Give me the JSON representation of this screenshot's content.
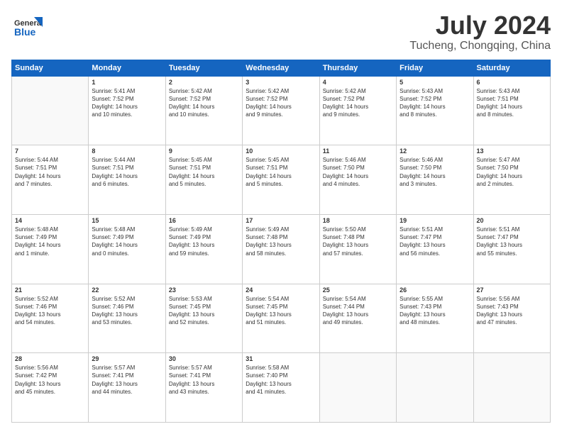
{
  "header": {
    "logo_line1": "General",
    "logo_line2": "Blue",
    "month": "July 2024",
    "location": "Tucheng, Chongqing, China"
  },
  "weekdays": [
    "Sunday",
    "Monday",
    "Tuesday",
    "Wednesday",
    "Thursday",
    "Friday",
    "Saturday"
  ],
  "weeks": [
    [
      {
        "day": "",
        "info": ""
      },
      {
        "day": "1",
        "info": "Sunrise: 5:41 AM\nSunset: 7:52 PM\nDaylight: 14 hours\nand 10 minutes."
      },
      {
        "day": "2",
        "info": "Sunrise: 5:42 AM\nSunset: 7:52 PM\nDaylight: 14 hours\nand 10 minutes."
      },
      {
        "day": "3",
        "info": "Sunrise: 5:42 AM\nSunset: 7:52 PM\nDaylight: 14 hours\nand 9 minutes."
      },
      {
        "day": "4",
        "info": "Sunrise: 5:42 AM\nSunset: 7:52 PM\nDaylight: 14 hours\nand 9 minutes."
      },
      {
        "day": "5",
        "info": "Sunrise: 5:43 AM\nSunset: 7:52 PM\nDaylight: 14 hours\nand 8 minutes."
      },
      {
        "day": "6",
        "info": "Sunrise: 5:43 AM\nSunset: 7:51 PM\nDaylight: 14 hours\nand 8 minutes."
      }
    ],
    [
      {
        "day": "7",
        "info": "Sunrise: 5:44 AM\nSunset: 7:51 PM\nDaylight: 14 hours\nand 7 minutes."
      },
      {
        "day": "8",
        "info": "Sunrise: 5:44 AM\nSunset: 7:51 PM\nDaylight: 14 hours\nand 6 minutes."
      },
      {
        "day": "9",
        "info": "Sunrise: 5:45 AM\nSunset: 7:51 PM\nDaylight: 14 hours\nand 5 minutes."
      },
      {
        "day": "10",
        "info": "Sunrise: 5:45 AM\nSunset: 7:51 PM\nDaylight: 14 hours\nand 5 minutes."
      },
      {
        "day": "11",
        "info": "Sunrise: 5:46 AM\nSunset: 7:50 PM\nDaylight: 14 hours\nand 4 minutes."
      },
      {
        "day": "12",
        "info": "Sunrise: 5:46 AM\nSunset: 7:50 PM\nDaylight: 14 hours\nand 3 minutes."
      },
      {
        "day": "13",
        "info": "Sunrise: 5:47 AM\nSunset: 7:50 PM\nDaylight: 14 hours\nand 2 minutes."
      }
    ],
    [
      {
        "day": "14",
        "info": "Sunrise: 5:48 AM\nSunset: 7:49 PM\nDaylight: 14 hours\nand 1 minute."
      },
      {
        "day": "15",
        "info": "Sunrise: 5:48 AM\nSunset: 7:49 PM\nDaylight: 14 hours\nand 0 minutes."
      },
      {
        "day": "16",
        "info": "Sunrise: 5:49 AM\nSunset: 7:49 PM\nDaylight: 13 hours\nand 59 minutes."
      },
      {
        "day": "17",
        "info": "Sunrise: 5:49 AM\nSunset: 7:48 PM\nDaylight: 13 hours\nand 58 minutes."
      },
      {
        "day": "18",
        "info": "Sunrise: 5:50 AM\nSunset: 7:48 PM\nDaylight: 13 hours\nand 57 minutes."
      },
      {
        "day": "19",
        "info": "Sunrise: 5:51 AM\nSunset: 7:47 PM\nDaylight: 13 hours\nand 56 minutes."
      },
      {
        "day": "20",
        "info": "Sunrise: 5:51 AM\nSunset: 7:47 PM\nDaylight: 13 hours\nand 55 minutes."
      }
    ],
    [
      {
        "day": "21",
        "info": "Sunrise: 5:52 AM\nSunset: 7:46 PM\nDaylight: 13 hours\nand 54 minutes."
      },
      {
        "day": "22",
        "info": "Sunrise: 5:52 AM\nSunset: 7:46 PM\nDaylight: 13 hours\nand 53 minutes."
      },
      {
        "day": "23",
        "info": "Sunrise: 5:53 AM\nSunset: 7:45 PM\nDaylight: 13 hours\nand 52 minutes."
      },
      {
        "day": "24",
        "info": "Sunrise: 5:54 AM\nSunset: 7:45 PM\nDaylight: 13 hours\nand 51 minutes."
      },
      {
        "day": "25",
        "info": "Sunrise: 5:54 AM\nSunset: 7:44 PM\nDaylight: 13 hours\nand 49 minutes."
      },
      {
        "day": "26",
        "info": "Sunrise: 5:55 AM\nSunset: 7:43 PM\nDaylight: 13 hours\nand 48 minutes."
      },
      {
        "day": "27",
        "info": "Sunrise: 5:56 AM\nSunset: 7:43 PM\nDaylight: 13 hours\nand 47 minutes."
      }
    ],
    [
      {
        "day": "28",
        "info": "Sunrise: 5:56 AM\nSunset: 7:42 PM\nDaylight: 13 hours\nand 45 minutes."
      },
      {
        "day": "29",
        "info": "Sunrise: 5:57 AM\nSunset: 7:41 PM\nDaylight: 13 hours\nand 44 minutes."
      },
      {
        "day": "30",
        "info": "Sunrise: 5:57 AM\nSunset: 7:41 PM\nDaylight: 13 hours\nand 43 minutes."
      },
      {
        "day": "31",
        "info": "Sunrise: 5:58 AM\nSunset: 7:40 PM\nDaylight: 13 hours\nand 41 minutes."
      },
      {
        "day": "",
        "info": ""
      },
      {
        "day": "",
        "info": ""
      },
      {
        "day": "",
        "info": ""
      }
    ]
  ]
}
